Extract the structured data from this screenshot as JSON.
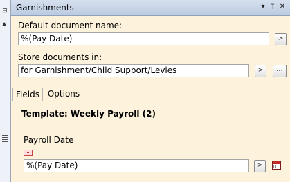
{
  "panel": {
    "title": "Garnishments",
    "controls": {
      "dropdown": "▾",
      "pin": "ᛘ",
      "close": "✕"
    }
  },
  "default_name": {
    "label": "Default document name:",
    "value": "%(Pay Date)",
    "button": ">"
  },
  "store": {
    "label": "Store documents in:",
    "value": "for Garnishment/Child Support/Levies",
    "button": ">",
    "browse": "..."
  },
  "tabs": [
    {
      "label": "Fields",
      "active": true
    },
    {
      "label": "Options",
      "active": false
    }
  ],
  "template": {
    "title": "Template: Weekly Payroll (2)"
  },
  "payroll_date": {
    "label": "Payroll Date",
    "value": "%(Pay Date)",
    "button": ">",
    "icon": "calendar-icon"
  },
  "left_strip": {
    "pin_glyph": "⊟",
    "caret_glyph": "▲"
  },
  "colors": {
    "panel_bg": "#fdf3dc",
    "titlebar": "#c7d4e6"
  }
}
